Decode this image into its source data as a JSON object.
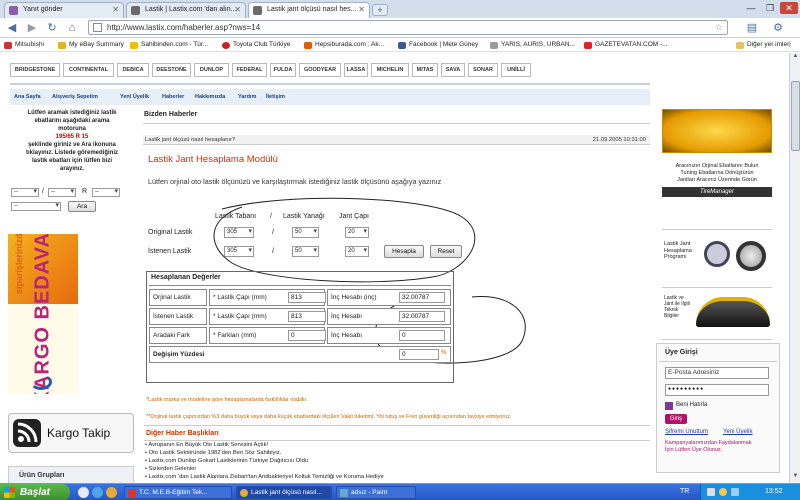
{
  "browser": {
    "tabs": [
      {
        "label": "Yanıt gönder"
      },
      {
        "label": "Lastik | Lastix.com 'dan alın..."
      },
      {
        "label": "Lastik jant ölçüsü nasıl hes..."
      }
    ],
    "url": "http://www.lastix.com/haberler.asp?nws=14",
    "bookmarks": [
      "Mitsubishi",
      "My eBay Summary",
      "Sahibinden.com - Tür...",
      "Toyota Club Türkiye",
      "Hepsiburada.com : Ak...",
      "Facebook | Mete Güney",
      "YARIS, AURIS, URBAN...",
      "GAZETEVATAN.COM -..."
    ],
    "other_bookmarks": "Diğer yer imleri"
  },
  "brands": [
    "BRIDGESTONE",
    "CONTINENTAL",
    "DEBICA",
    "DEESTONE",
    "DUNLOP",
    "FEDERAL",
    "FULDA",
    "GOODYEAR",
    "LASSA",
    "MICHELIN",
    "MITAS",
    "SAVA",
    "SONAR",
    "UNİLLİ"
  ],
  "menu": [
    "Ana Sayfa",
    "Alışveriş Sepetim",
    "Yeni Üyelik",
    "Haberler",
    "Hakkımızda",
    "Yardım",
    "İletişim"
  ],
  "left": {
    "search_text_1": "Lütfen aramak istediğiniz lastik",
    "search_text_2": "ebatlarını aşağıdaki arama",
    "search_text_3": "motoruna",
    "search_example": "195/65 R 15",
    "search_text_4": "şeklinde giriniz ve Ara ikonuna",
    "search_text_5": "tıklayınız. Listede göremediğiniz",
    "search_text_6": "lastik ebatları için lütfen bizi",
    "search_text_7": "arayınız.",
    "sel_placeholder": "--",
    "sep_slash": "/",
    "sep_r": "R",
    "search_button": "Ara",
    "cargo_text": "KARGO BEDAVA",
    "siparis_text": "siparişlerinizde",
    "kargo_takip": "Kargo Takip",
    "urun_gruplari": "Ürün Grupları"
  },
  "center": {
    "section_title": "Bizden Haberler",
    "breadcrumb": "Lastik jant ölçüsü nasıl hesaplanır?",
    "date": "21.09.2005 10:31:00",
    "module_title": "Lastik Jant Hesaplama Modülü",
    "intro": "Lütfen orjinal oto lastik ölçünüzü ve karşılaştırmak istediğiniz lastik ölçüsünü aşağıya yazınız",
    "headers": {
      "taban": "Lastik Tabanı",
      "slash": "/",
      "yanak": "Lastik Yanağı",
      "jant": "Jant Çapı"
    },
    "original_label": "Original Lastik",
    "istenen_label": "İstenen Lastik",
    "original": {
      "taban": "305",
      "yanak": "50",
      "jant": "20"
    },
    "istenen": {
      "taban": "305",
      "yanak": "50",
      "jant": "20"
    },
    "hesapla": "Hesapla",
    "reset": "Reset",
    "results_title": "Hesaplanan Değerler",
    "rows": [
      {
        "label": "Orjinal Lastik",
        "cap_label": "* Lastik Çapı (mm)",
        "cap": "813",
        "inc_label": "İnç Hesabı (inç)",
        "inc": "32.00787"
      },
      {
        "label": "İstenen Lastik",
        "cap_label": "* Lastik Çapı (mm)",
        "cap": "813",
        "inc_label": "İnç Hesabı",
        "inc": "32.00787"
      },
      {
        "label": "Aradaki Fark",
        "cap_label": "* Farkları      (mm)",
        "cap": "0",
        "inc_label": "İnç Hesabı",
        "inc": "0"
      }
    ],
    "degisim_label": "Değişim Yüzdesi",
    "degisim_value": "0",
    "percent": "%",
    "note1": "*Lastik marka ve modeline göre hesaplamalarda  farklılıklar olabilir.",
    "note2": "**Orijinal lastik çapınızdan %3 daha büyük veya daha küçük ebatlardaki ölçüleri Vakit tüketimi, Yol tutuş ve Fren güvenliği açısından tavsiye etmiyoruz.",
    "other_news_title": "Diğer Haber Başlıkları",
    "other_news": [
      "Avrupanın En Büyük Oto Lastik Servisini Açtık!",
      "Oto Lastik Sektöründe 1982'den Beri Söz Sahibiyiz.",
      "Lastix.com Dunlop Gokart Lastiklerinin Türkiye Dağıtıcısı Oldu",
      "Sizlerden Gelenler",
      "Lastix.com 'dan Lastik Alanlara Ziebart'tan Antibakteriyel Koltuk Temizliği ve Koruma Hediye"
    ]
  },
  "right": {
    "banner2_1": "Aracınızın Orjinal Ebatlarını Bulun",
    "banner2_2": "Tuning Ebatlarına Dönüştürün",
    "banner2_3": "Jantları Aracınız Üzerinde Görün",
    "tiremanager": "TireManager",
    "jant_prog": "Lastik Jant Hesaplama Programı",
    "teknik": "Lastik ve Jant ile İlgili Teknik Bilgiler",
    "login_title": "Üye Girişi",
    "email_placeholder": "E-Posta Adresiniz",
    "password_mask": "●●●●●●●●●",
    "remember": "Beni Hatırla",
    "login_button": "Giriş",
    "forgot": "Şifremi Unuttum",
    "new_member": "Yeni Üyelik",
    "promo_1": "Kampanyalarımızdan Faydalanmak",
    "promo_2": "İçin Lütfen Üye Olunuz."
  },
  "taskbar": {
    "start": "Başlat",
    "tasks": [
      "T.C. M.E.B-Eğitim Tek...",
      "Lastik jant ölçüsü nasıl...",
      "adsız - Paint"
    ],
    "lang": "TR",
    "clock": "13:52"
  },
  "colors": {
    "accent": "#cc3300",
    "link": "#1a3f7a",
    "taskbar": "#2457c8",
    "tab_bg": "#d3deed"
  }
}
